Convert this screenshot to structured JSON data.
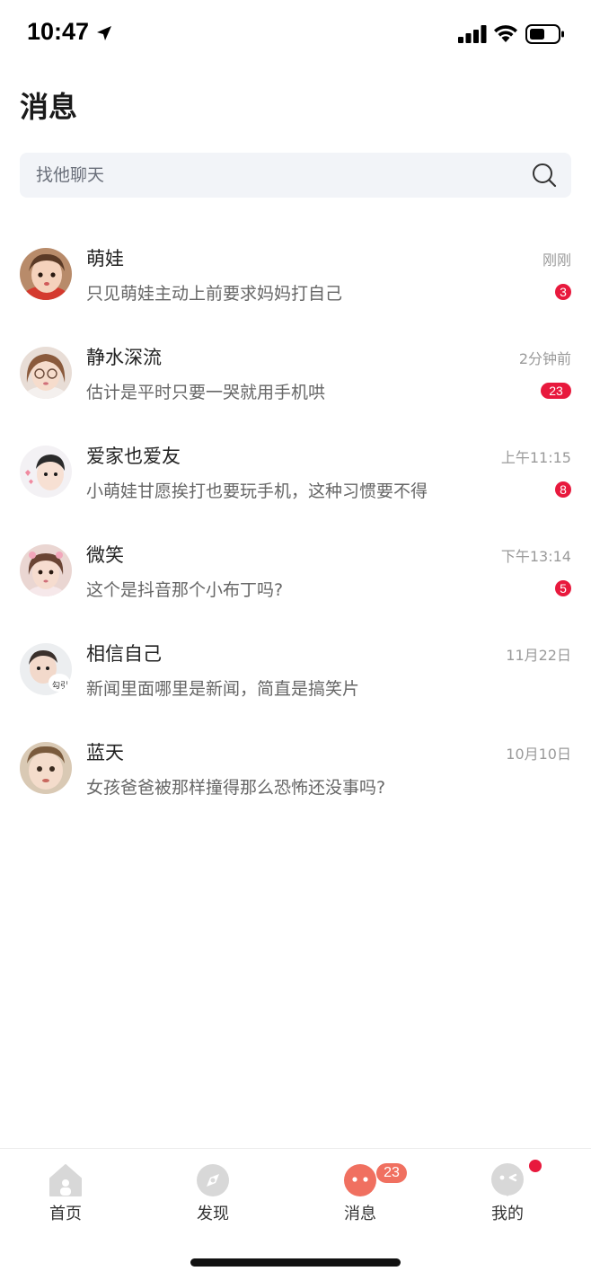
{
  "status_bar": {
    "time": "10:47"
  },
  "page": {
    "title": "消息"
  },
  "search": {
    "placeholder": "找他聊天"
  },
  "chats": [
    {
      "name": "萌娃",
      "time": "刚刚",
      "preview": "只见萌娃主动上前要求妈妈打自己",
      "unread": "3"
    },
    {
      "name": "静水深流",
      "time": "2分钟前",
      "preview": "估计是平时只要一哭就用手机哄",
      "unread": "23"
    },
    {
      "name": "爱家也爱友",
      "time": "上午11:15",
      "preview": "小萌娃甘愿挨打也要玩手机，这种习惯要不得",
      "unread": "8"
    },
    {
      "name": "微笑",
      "time": "下午13:14",
      "preview": "这个是抖音那个小布丁吗?",
      "unread": "5"
    },
    {
      "name": "相信自己",
      "time": "11月22日",
      "preview": "新闻里面哪里是新闻，简直是搞笑片",
      "avatar_text": "勾引"
    },
    {
      "name": "蓝天",
      "time": "10月10日",
      "preview": "女孩爸爸被那样撞得那么恐怖还没事吗?"
    }
  ],
  "tabs": [
    {
      "label": "首页",
      "icon": "home-icon"
    },
    {
      "label": "发现",
      "icon": "compass-icon"
    },
    {
      "label": "消息",
      "icon": "chat-bubble-icon",
      "badge": "23"
    },
    {
      "label": "我的",
      "icon": "profile-face-icon"
    }
  ],
  "colors": {
    "accent": "#e8193d",
    "tab_active": "#f07060",
    "tab_inactive": "#d8d8d8"
  }
}
